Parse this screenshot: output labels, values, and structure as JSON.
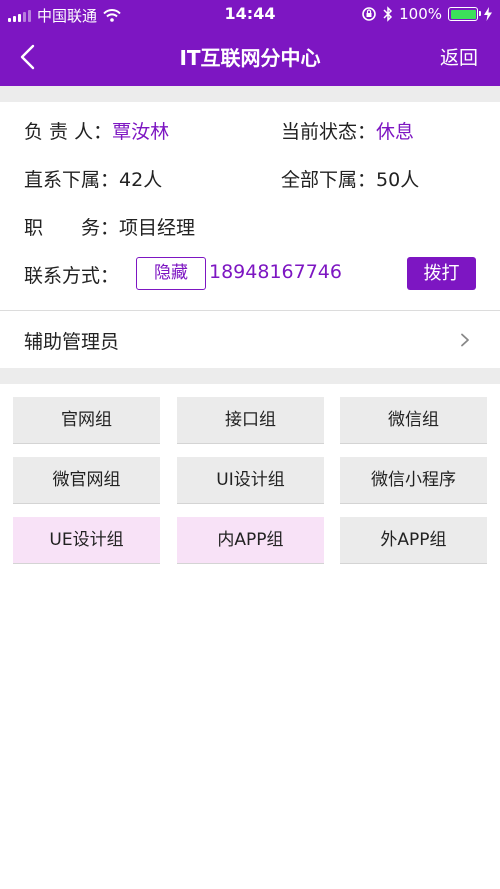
{
  "status_bar": {
    "carrier": "中国联通",
    "time": "14:44",
    "battery": "100%"
  },
  "header": {
    "title": "IT互联网分中心",
    "right_label": "返回",
    "background_color": "#7d16c2"
  },
  "info": {
    "manager_label": "负 责 人：",
    "manager_value": "覃汝林",
    "status_label": "当前状态：",
    "status_value": "休息",
    "direct_label": "直系下属：",
    "direct_value": "42人",
    "all_label": "全部下属：",
    "all_value": "50人",
    "position_label": "职　　务：",
    "position_value": "项目经理",
    "contact_label": "联系方式：",
    "hide_button": "隐藏",
    "phone": "18948167746",
    "dial_button": "拨打"
  },
  "assistant": {
    "label": "辅助管理员"
  },
  "groups": [
    {
      "label": "官网组",
      "selected": false
    },
    {
      "label": "接口组",
      "selected": false
    },
    {
      "label": "微信组",
      "selected": false
    },
    {
      "label": "微官网组",
      "selected": false
    },
    {
      "label": "UI设计组",
      "selected": false
    },
    {
      "label": "微信小程序",
      "selected": false
    },
    {
      "label": "UE设计组",
      "selected": true
    },
    {
      "label": "内APP组",
      "selected": true
    },
    {
      "label": "外APP组",
      "selected": false
    }
  ],
  "colors": {
    "accent": "#7d16c2",
    "selected_group_bg": "#f8e2f7",
    "group_bg": "#ebebeb"
  }
}
